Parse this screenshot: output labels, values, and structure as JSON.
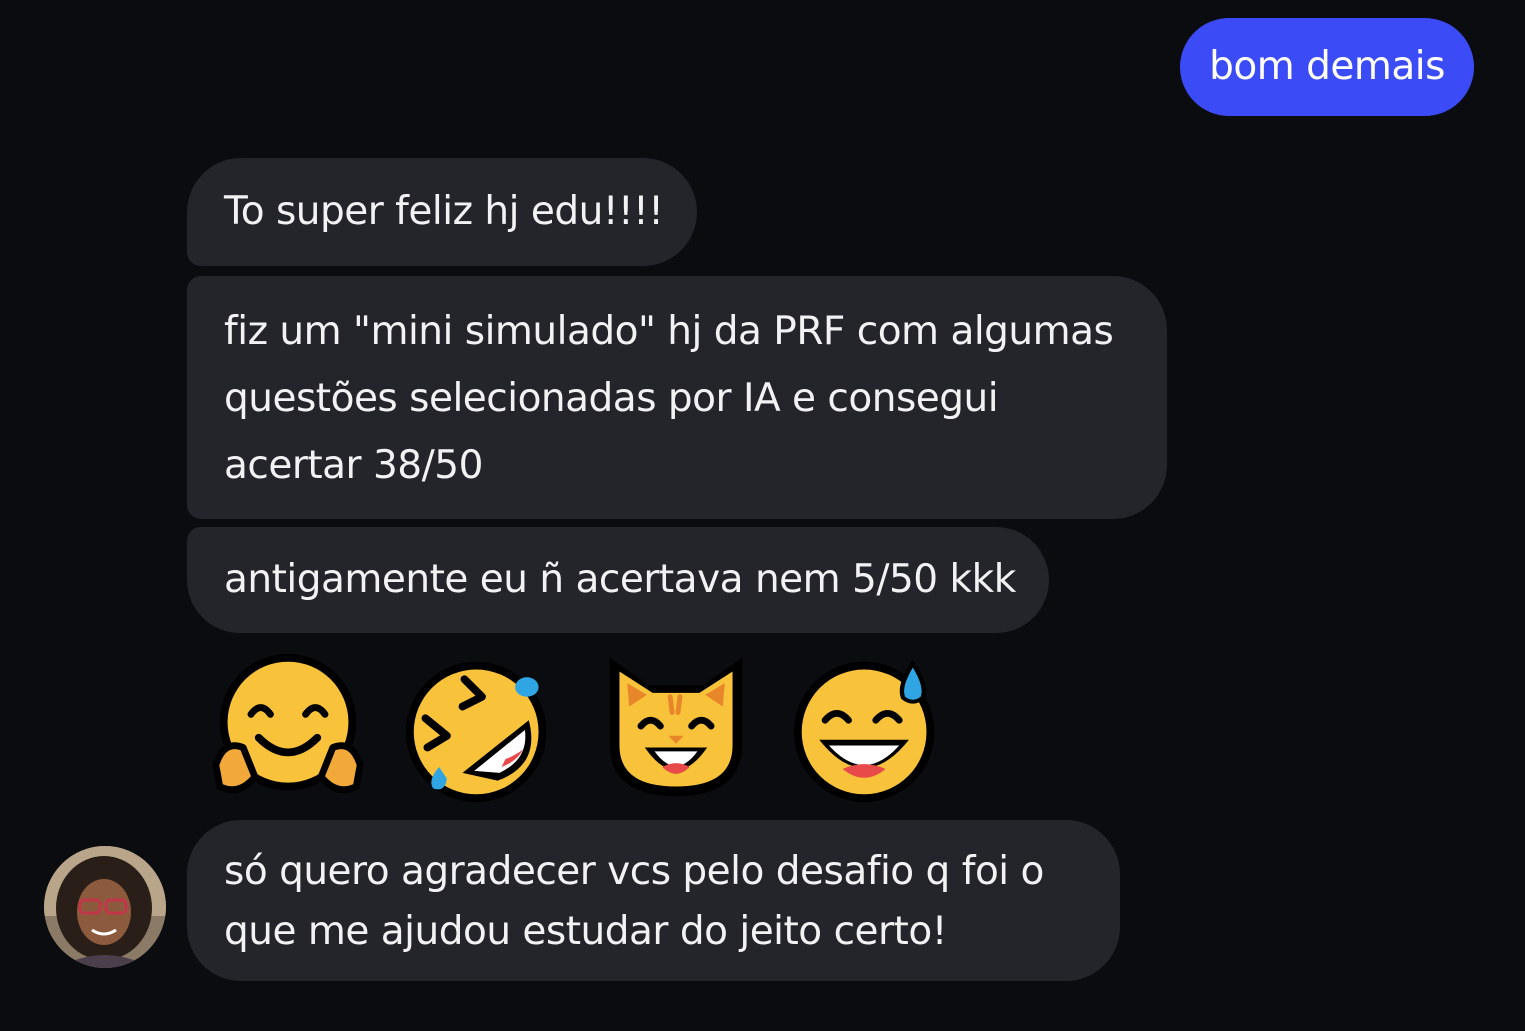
{
  "outgoing": {
    "text": "bom demais"
  },
  "incoming": {
    "messages": [
      "To super feliz hj edu!!!!",
      "fiz um \"mini simulado\" hj da PRF com algumas questões selecionadas por IA  e consegui acertar 38/50",
      "antigamente eu ñ acertava nem 5/50 kkk",
      "só quero agradecer vcs pelo desafio q foi o que me ajudou estudar do jeito certo!"
    ],
    "emojis": [
      "hugging-face-icon",
      "rolling-on-floor-laughing-icon",
      "grinning-cat-icon",
      "grinning-face-with-sweat-icon"
    ]
  },
  "colors": {
    "background": "#0b0c10",
    "incoming_bubble": "#24252b",
    "outgoing_bubble": "#3b4cf7",
    "text": "#f2f2f4"
  }
}
